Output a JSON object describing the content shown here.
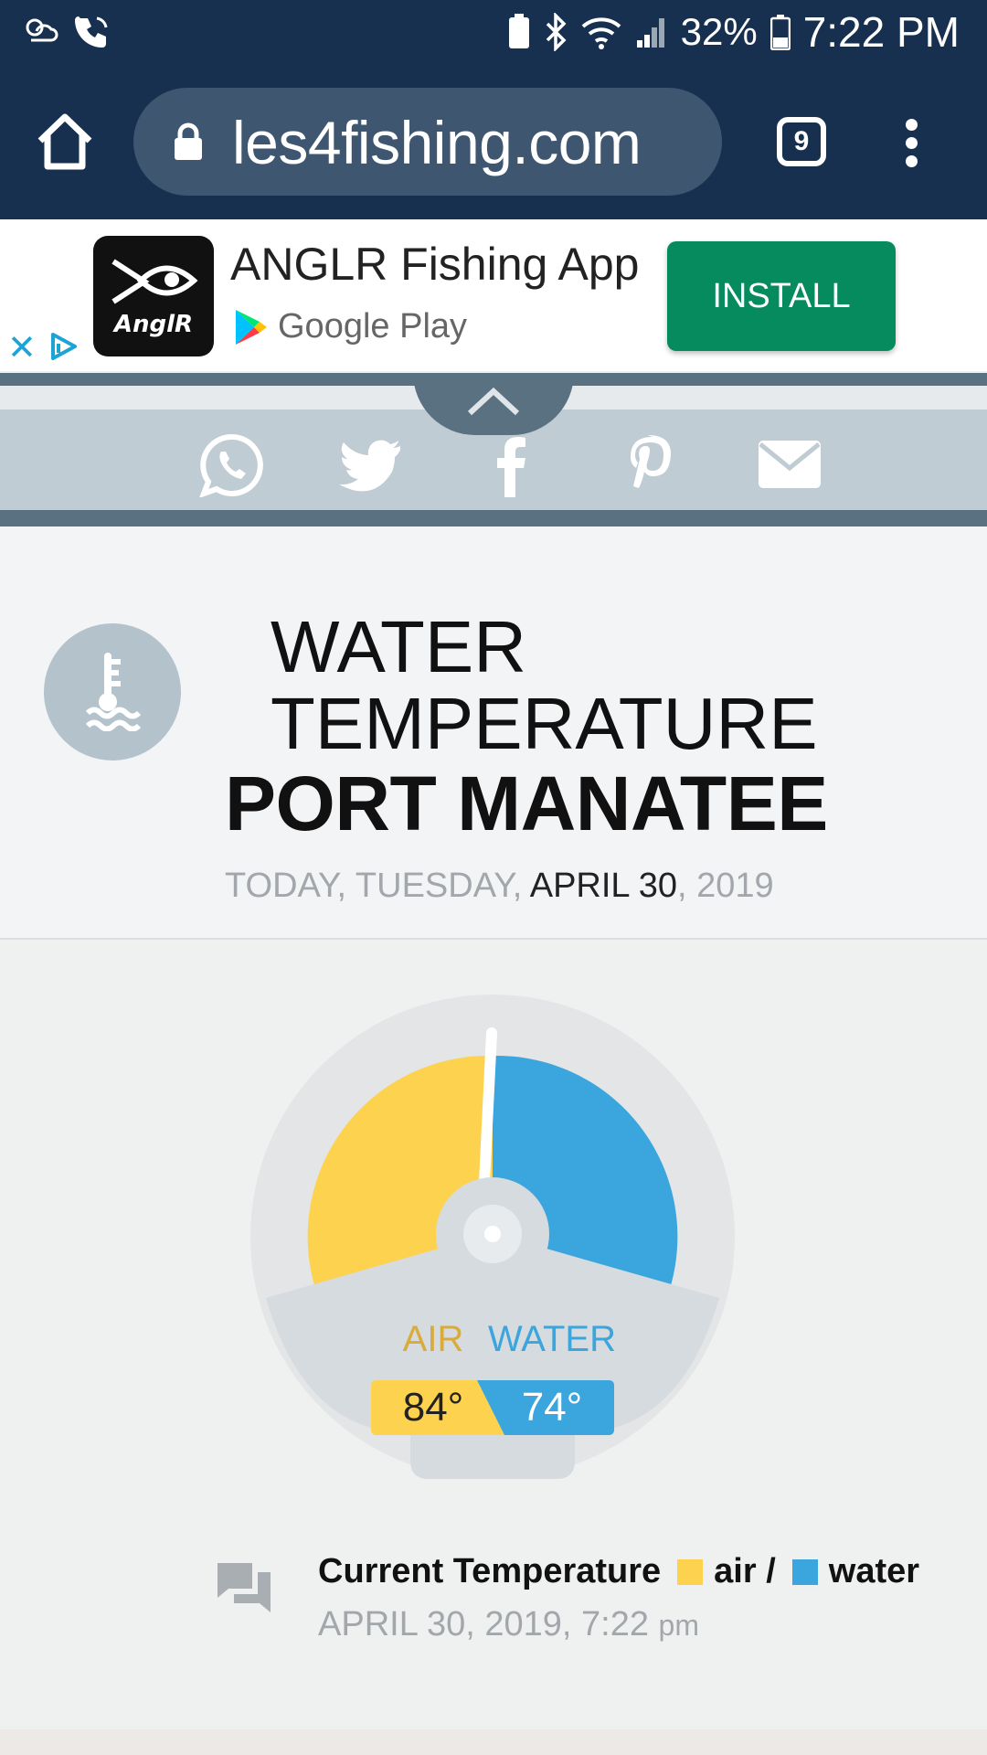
{
  "status_bar": {
    "battery_percent": "32%",
    "time": "7:22 PM"
  },
  "browser": {
    "url": "les4fishing.com",
    "tab_count": "9"
  },
  "ad": {
    "app_name": "ANGLR Fishing App",
    "logo_text": "AnglR",
    "store": "Google Play",
    "install_label": "INSTALL"
  },
  "share": {
    "icons": [
      "whatsapp-icon",
      "twitter-icon",
      "facebook-icon",
      "pinterest-icon",
      "mail-icon"
    ]
  },
  "header": {
    "line1": "WATER",
    "line2": "TEMPERATURE",
    "line3": "PORT MANATEE",
    "date_prefix": "TODAY, TUESDAY,",
    "date_highlight": "APRIL 30",
    "date_suffix": ", 2019"
  },
  "gauge": {
    "air_label": "AIR",
    "water_label": "WATER",
    "air_value": "84°",
    "water_value": "74°",
    "air_color": "#fdd24f",
    "water_color": "#3ba5dd"
  },
  "current": {
    "label": "Current Temperature",
    "air": "air /",
    "water": "water",
    "date": "APRIL 30, 2019, 7:22",
    "ampm": "pm"
  }
}
